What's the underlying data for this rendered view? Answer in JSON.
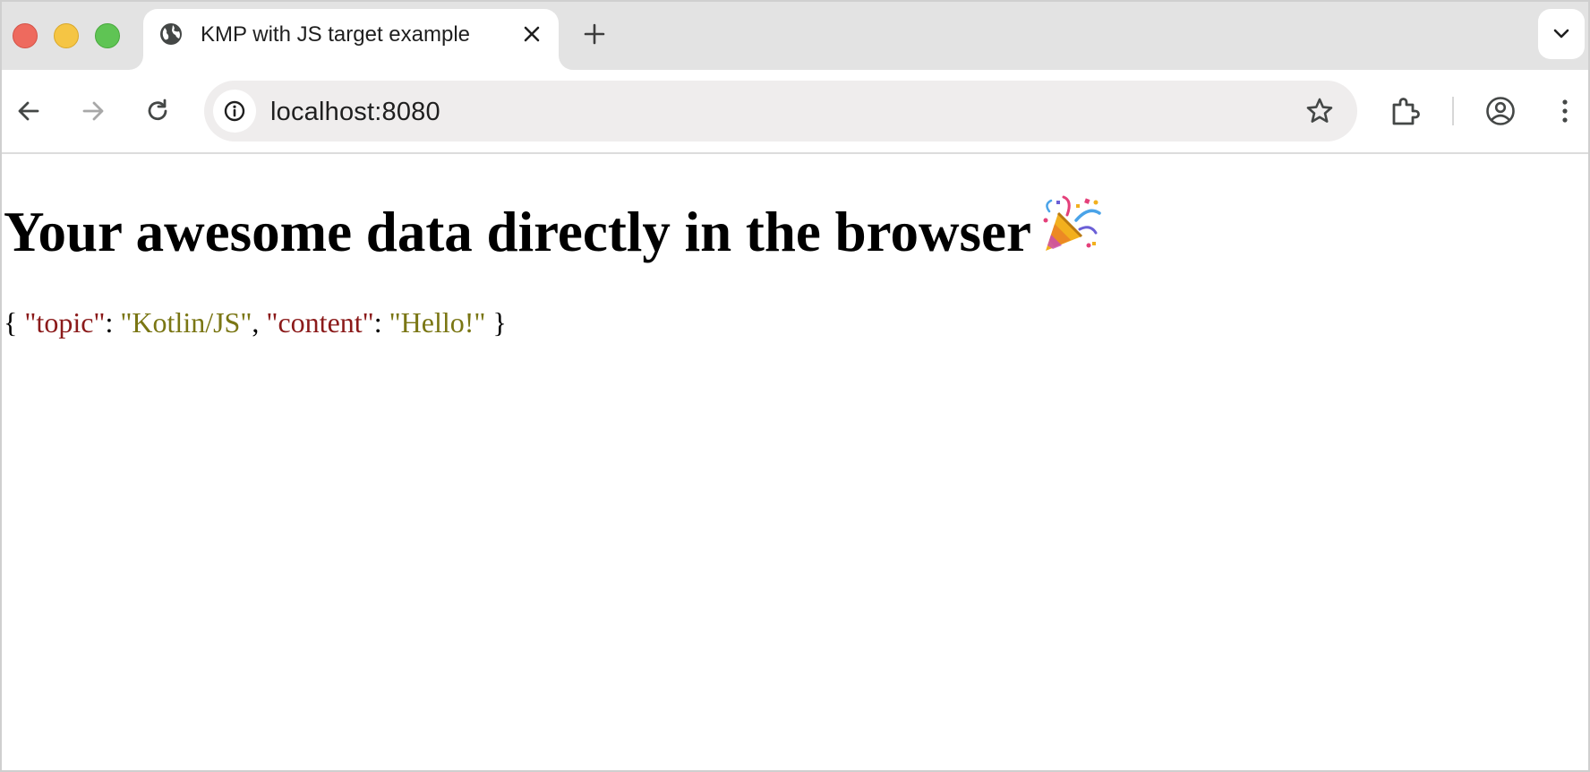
{
  "browser": {
    "tab": {
      "title": "KMP with JS target example",
      "favicon": "globe-icon"
    },
    "address_bar": {
      "url": "localhost:8080"
    },
    "icons": {
      "back": "arrow-left-icon",
      "forward": "arrow-right-icon",
      "reload": "reload-icon",
      "site_info": "info-icon",
      "bookmark": "star-icon",
      "extensions": "puzzle-icon",
      "profile": "account-icon",
      "menu": "kebab-icon",
      "tab_search": "chevron-down-icon",
      "new_tab": "plus-icon",
      "close_tab": "close-icon"
    }
  },
  "page": {
    "heading": "Your awesome data directly in the browser",
    "heading_emoji": "party-popper-icon",
    "json": {
      "open_brace": "{",
      "key1": "\"topic\"",
      "colon1": ":",
      "value1": "\"Kotlin/JS\"",
      "comma": ",",
      "key2": "\"content\"",
      "colon2": ":",
      "value2": "\"Hello!\"",
      "close_brace": "}"
    }
  },
  "colors": {
    "json_key": "#8b1a1a",
    "json_string": "#7a7614",
    "tab_strip": "#e3e3e3",
    "omnibox": "#efeded"
  }
}
